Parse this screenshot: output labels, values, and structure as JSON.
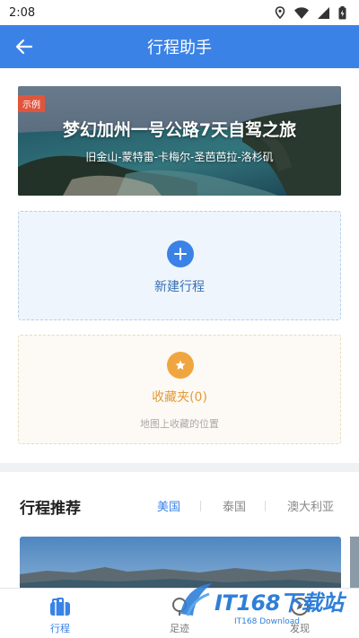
{
  "status_bar": {
    "time": "2:08"
  },
  "header": {
    "title": "行程助手"
  },
  "hero": {
    "tag": "示例",
    "title": "梦幻加州一号公路7天自驾之旅",
    "route": "旧金山-蒙特雷-卡梅尔-圣芭芭拉-洛杉矶"
  },
  "new_trip": {
    "label": "新建行程"
  },
  "favorites": {
    "label": "收藏夹(0)",
    "description": "地图上收藏的位置"
  },
  "recommend": {
    "title": "行程推荐",
    "tabs": [
      {
        "label": "美国",
        "active": true
      },
      {
        "label": "泰国",
        "active": false
      },
      {
        "label": "澳大利亚",
        "active": false
      }
    ]
  },
  "bottom_nav": {
    "items": [
      {
        "label": "行程",
        "icon": "suitcase-icon",
        "active": true
      },
      {
        "label": "足迹",
        "icon": "footprint-icon",
        "active": false
      },
      {
        "label": "发现",
        "icon": "discover-icon",
        "active": false
      }
    ]
  },
  "watermark": {
    "text": "IT168下载站",
    "sub": "IT168 Download"
  },
  "colors": {
    "primary": "#3b82e6",
    "accent_orange": "#f0a640",
    "tag_red": "#e0553c"
  }
}
